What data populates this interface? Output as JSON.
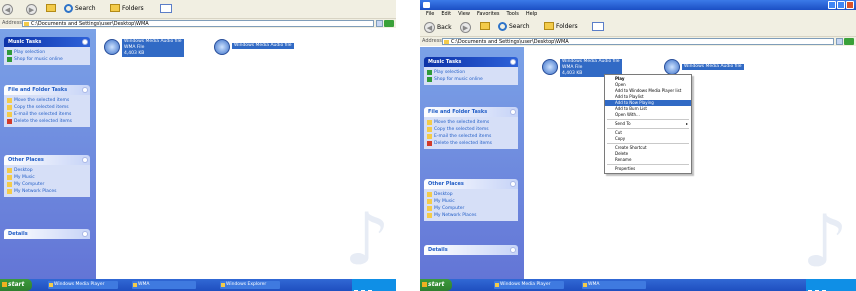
{
  "screenshot_left": {
    "toolbar": {
      "back_label": "",
      "search_label": "Search",
      "folders_label": "Folders"
    },
    "address": {
      "label": "Address",
      "value": "C:\\Documents and Settings\\user\\Desktop\\WMA"
    },
    "panels": [
      {
        "title": "Music Tasks",
        "dark": true,
        "tasks": [
          "Play selection",
          "Shop for music online"
        ]
      },
      {
        "title": "File and Folder Tasks",
        "dark": false,
        "tasks": [
          "Move the selected items",
          "Copy the selected items",
          "E-mail the selected items",
          "Delete the selected items"
        ]
      },
      {
        "title": "Other Places",
        "dark": false,
        "tasks": [
          "Desktop",
          "My Music",
          "My Computer",
          "My Network Places"
        ]
      },
      {
        "title": "Details",
        "dark": false,
        "tasks": []
      }
    ],
    "files": [
      {
        "lines": [
          "Windows Media Audio file",
          "WMA File",
          "4,403 KB"
        ]
      },
      {
        "lines": [
          "Windows Media Audio file"
        ]
      }
    ],
    "taskbar": {
      "start_label": "start",
      "items": [
        "Windows Media Player",
        "WMA",
        "Windows Explorer"
      ]
    }
  },
  "screenshot_right": {
    "title": "",
    "menu": [
      "File",
      "Edit",
      "View",
      "Favorites",
      "Tools",
      "Help"
    ],
    "toolbar": {
      "back_label": "Back",
      "search_label": "Search",
      "folders_label": "Folders"
    },
    "address": {
      "label": "Address",
      "value": "C:\\Documents and Settings\\user\\Desktop\\WMA"
    },
    "panels": [
      {
        "title": "Music Tasks",
        "dark": true,
        "tasks": [
          "Play selection",
          "Shop for music online"
        ]
      },
      {
        "title": "File and Folder Tasks",
        "dark": false,
        "tasks": [
          "Move the selected items",
          "Copy the selected items",
          "E-mail the selected items",
          "Delete the selected items"
        ]
      },
      {
        "title": "Other Places",
        "dark": false,
        "tasks": [
          "Desktop",
          "My Music",
          "My Computer",
          "My Network Places"
        ]
      },
      {
        "title": "Details",
        "dark": false,
        "tasks": []
      }
    ],
    "files": [
      {
        "lines": [
          "Windows Media Audio file",
          "WMA File",
          "4,403 KB"
        ]
      },
      {
        "lines": [
          "Windows Media Audio file"
        ]
      }
    ],
    "context_menu": [
      {
        "label": "Play",
        "bold": true
      },
      {
        "label": "Open"
      },
      {
        "label": "Add to Windows Media Player list"
      },
      {
        "label": "Add to Playlist"
      },
      {
        "label": "Add to Now Playing",
        "highlight": true
      },
      {
        "label": "Add to Burn List"
      },
      {
        "label": "Open With...",
        "sep_after": true
      },
      {
        "label": "Send To",
        "submenu": true,
        "sep_after": true
      },
      {
        "label": "Cut"
      },
      {
        "label": "Copy",
        "sep_after": true
      },
      {
        "label": "Create Shortcut"
      },
      {
        "label": "Delete"
      },
      {
        "label": "Rename",
        "sep_after": true
      },
      {
        "label": "Properties"
      }
    ],
    "taskbar": {
      "start_label": "start",
      "items": [
        "Windows Media Player",
        "WMA"
      ]
    }
  },
  "colors": {
    "xp_blue": "#316ac5",
    "task_pane": "#6375d6",
    "taskbar": "#1f4fbf",
    "start_green": "#2f7f2f"
  }
}
